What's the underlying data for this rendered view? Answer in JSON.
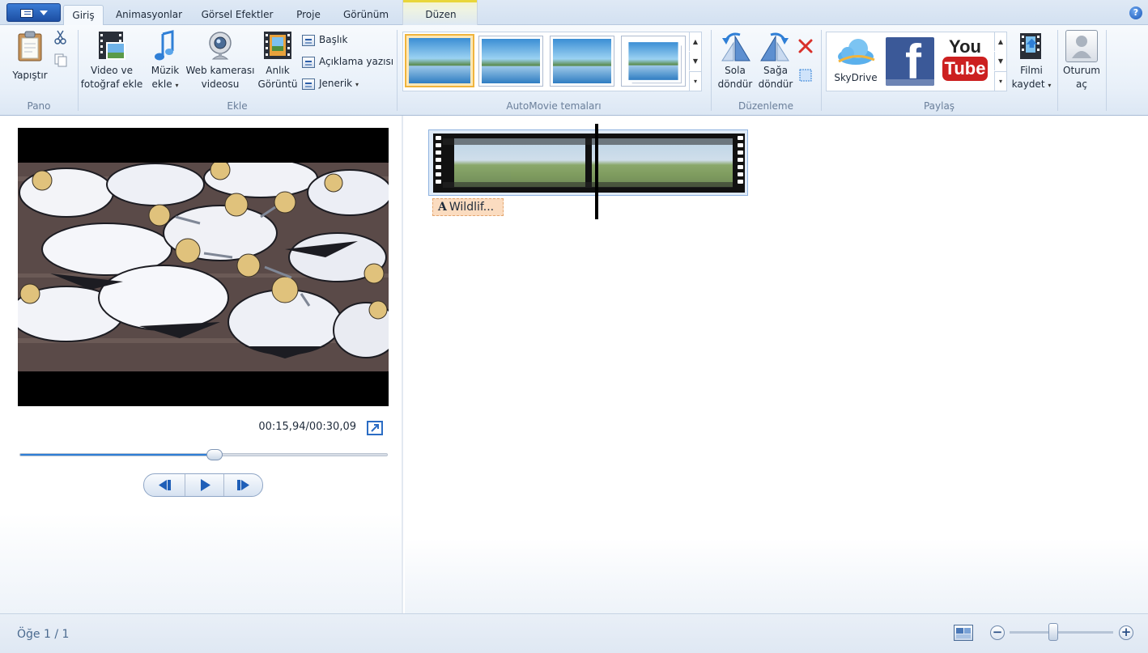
{
  "tabs": [
    {
      "label": "Giriş",
      "active": true
    },
    {
      "label": "Animasyonlar"
    },
    {
      "label": "Görsel Efektler"
    },
    {
      "label": "Proje"
    },
    {
      "label": "Görünüm"
    }
  ],
  "context_tab": {
    "label": "Düzen"
  },
  "help_label": "?",
  "ribbon": {
    "pano": {
      "label": "Pano",
      "paste": "Yapıştır"
    },
    "ekle": {
      "label": "Ekle",
      "add_video_line1": "Video ve",
      "add_video_line2": "fotoğraf ekle",
      "add_music_line1": "Müzik",
      "add_music_line2": "ekle",
      "webcam_line1": "Web kamerası",
      "webcam_line2": "videosu",
      "snapshot_line1": "Anlık",
      "snapshot_line2": "Görüntü",
      "title": "Başlık",
      "caption": "Açıklama yazısı",
      "credits": "Jenerik"
    },
    "automovie": {
      "label": "AutoMovie temaları",
      "selected_index": 0
    },
    "duzenleme": {
      "label": "Düzenleme",
      "rotate_left_line1": "Sola",
      "rotate_left_line2": "döndür",
      "rotate_right_line1": "Sağa",
      "rotate_right_line2": "döndür"
    },
    "paylas": {
      "label": "Paylaş",
      "skydrive": "SkyDrive",
      "facebook": "f",
      "youtube_top": "You",
      "youtube_bottom": "Tube",
      "save_movie_line1": "Filmi",
      "save_movie_line2": "kaydet"
    },
    "signin_line1": "Oturum",
    "signin_line2": "aç"
  },
  "preview": {
    "time": "00:15,94/00:30,09",
    "progress": 0.53
  },
  "storyboard": {
    "caption_text": "Wildlif...",
    "caption_icon": "A",
    "playhead_fraction": 0.53
  },
  "status": {
    "item_count": "Öğe 1 / 1",
    "zoom_fraction": 0.42,
    "zoom_out": "−",
    "zoom_in": "+"
  },
  "colors": {
    "accent": "#2f7fd6",
    "selection": "#f0b43c",
    "delete_red": "#d9302a",
    "facebook_blue": "#3b5998",
    "youtube_red": "#cc2020"
  }
}
